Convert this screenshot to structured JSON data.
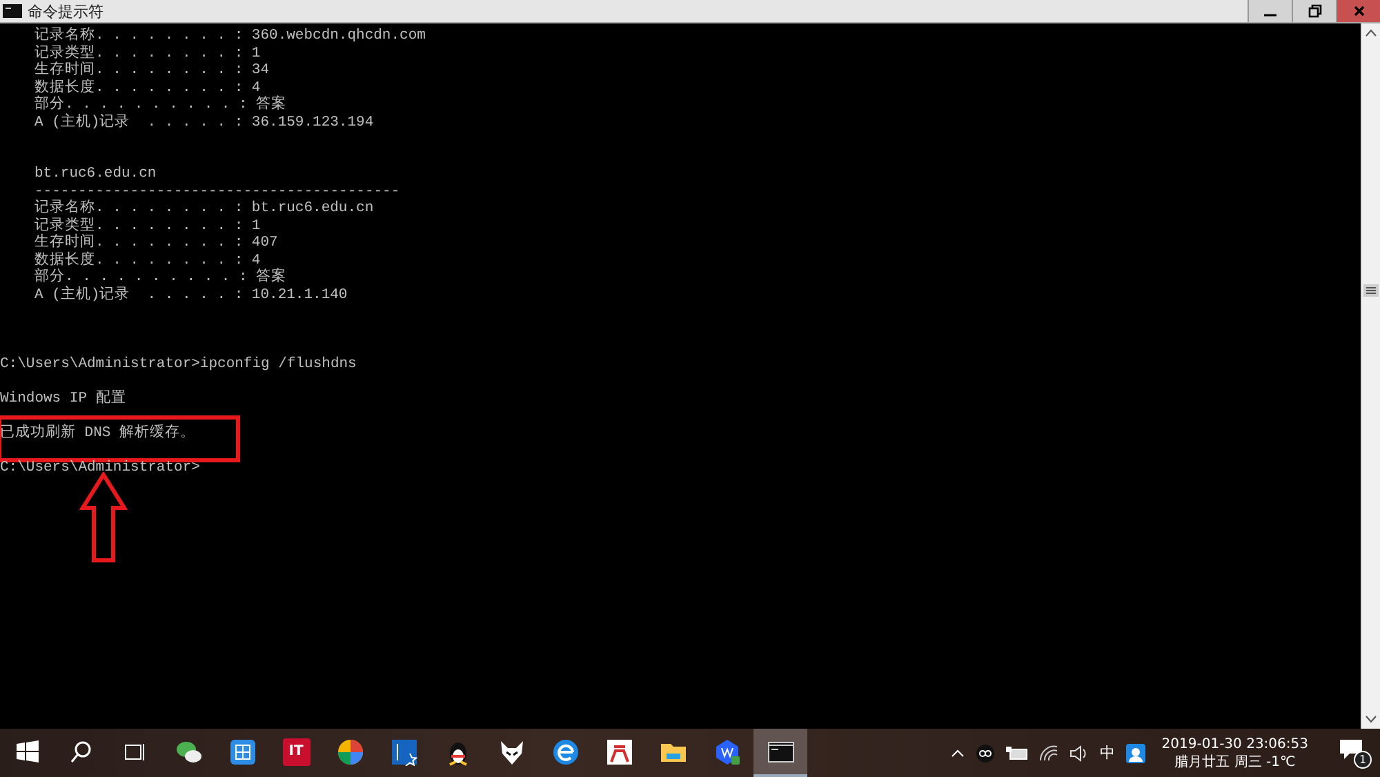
{
  "window": {
    "title": "命令提示符"
  },
  "console": {
    "lines": [
      {
        "kind": "indented",
        "text": "记录名称. . . . . . . . : 360.webcdn.qhcdn.com"
      },
      {
        "kind": "indented",
        "text": "记录类型. . . . . . . . : 1"
      },
      {
        "kind": "indented",
        "text": "生存时间. . . . . . . . : 34"
      },
      {
        "kind": "indented",
        "text": "数据长度. . . . . . . . : 4"
      },
      {
        "kind": "indented",
        "text": "部分. . . . . . . . . . : 答案"
      },
      {
        "kind": "indented",
        "text": "A (主机)记录  . . . . . : 36.159.123.194"
      },
      {
        "kind": "blank"
      },
      {
        "kind": "blank"
      },
      {
        "kind": "indented",
        "text": "bt.ruc6.edu.cn"
      },
      {
        "kind": "indented",
        "text": "------------------------------------------"
      },
      {
        "kind": "indented",
        "text": "记录名称. . . . . . . . : bt.ruc6.edu.cn"
      },
      {
        "kind": "indented",
        "text": "记录类型. . . . . . . . : 1"
      },
      {
        "kind": "indented",
        "text": "生存时间. . . . . . . . : 407"
      },
      {
        "kind": "indented",
        "text": "数据长度. . . . . . . . : 4"
      },
      {
        "kind": "indented",
        "text": "部分. . . . . . . . . . : 答案"
      },
      {
        "kind": "indented",
        "text": "A (主机)记录  . . . . . : 10.21.1.140"
      },
      {
        "kind": "blank"
      },
      {
        "kind": "blank"
      },
      {
        "kind": "blank"
      },
      {
        "kind": "plain",
        "text": "C:\\Users\\Administrator>ipconfig /flushdns"
      },
      {
        "kind": "blank"
      },
      {
        "kind": "plain",
        "text": "Windows IP 配置"
      },
      {
        "kind": "blank"
      },
      {
        "kind": "plain",
        "text": "已成功刷新 DNS 解析缓存。",
        "highlighted": true
      },
      {
        "kind": "blank"
      },
      {
        "kind": "plain",
        "text": "C:\\Users\\Administrator>"
      }
    ]
  },
  "taskbar": {
    "apps": [
      {
        "kind": "start",
        "selected": false
      },
      {
        "kind": "search",
        "selected": false
      },
      {
        "kind": "taskview",
        "selected": false
      },
      {
        "kind": "chat",
        "selected": false
      },
      {
        "kind": "grid",
        "selected": false
      },
      {
        "kind": "it",
        "label": "IT",
        "selected": false
      },
      {
        "kind": "pinwheel",
        "selected": false
      },
      {
        "kind": "tools",
        "selected": false
      },
      {
        "kind": "penguin",
        "selected": false
      },
      {
        "kind": "fox",
        "selected": false
      },
      {
        "kind": "browser",
        "selected": false
      },
      {
        "kind": "redapp",
        "selected": false
      },
      {
        "kind": "folder",
        "selected": false
      },
      {
        "kind": "office",
        "selected": false
      },
      {
        "kind": "console",
        "selected": true
      }
    ],
    "tray": {
      "ime": "中",
      "date": "2019-01-30 23:06:53",
      "lunar": "腊月廿五 周三 -1℃",
      "notifications": "1"
    }
  }
}
